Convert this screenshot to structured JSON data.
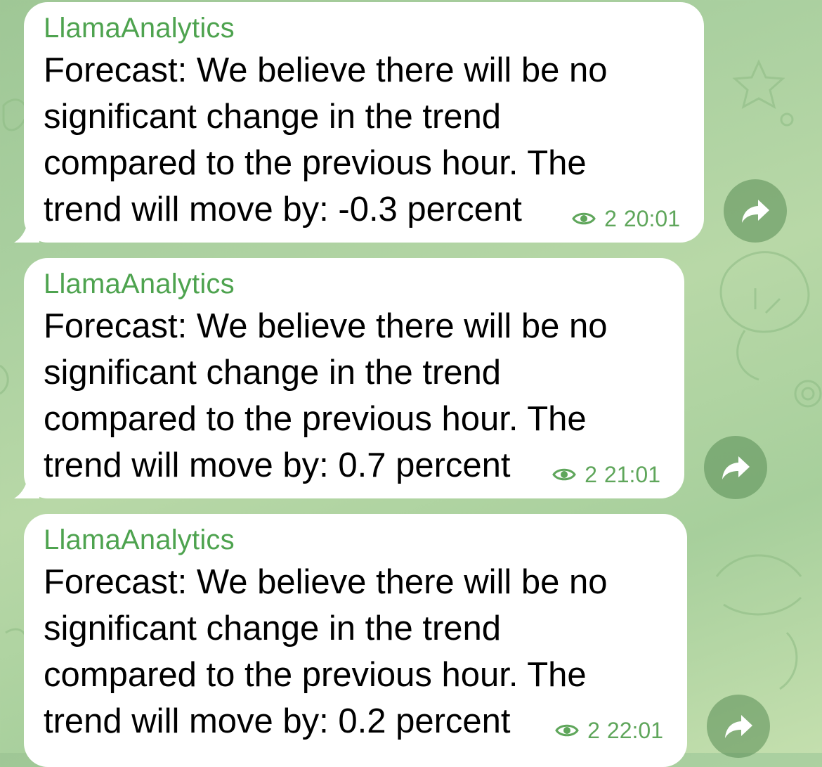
{
  "colors": {
    "sender": "#4ea34f",
    "meta": "#5fa65b",
    "bubble": "#ffffff",
    "share_button": "#6f9a69"
  },
  "messages": [
    {
      "sender": "LlamaAnalytics",
      "text": "Forecast: We believe there will be no significant change in the trend compared to the previous hour. The trend will move by: -0.3 percent",
      "views": "2",
      "time": "20:01"
    },
    {
      "sender": "LlamaAnalytics",
      "text": "Forecast: We believe there will be no significant change in the trend compared to the previous hour. The trend will move by: 0.7 percent",
      "views": "2",
      "time": "21:01"
    },
    {
      "sender": "LlamaAnalytics",
      "text": "Forecast: We believe there will be no significant change in the trend compared to the previous hour. The trend will move by: 0.2 percent",
      "views": "2",
      "time": "22:01"
    }
  ],
  "icons": {
    "views": "eye-icon",
    "share": "share-arrow-icon"
  }
}
